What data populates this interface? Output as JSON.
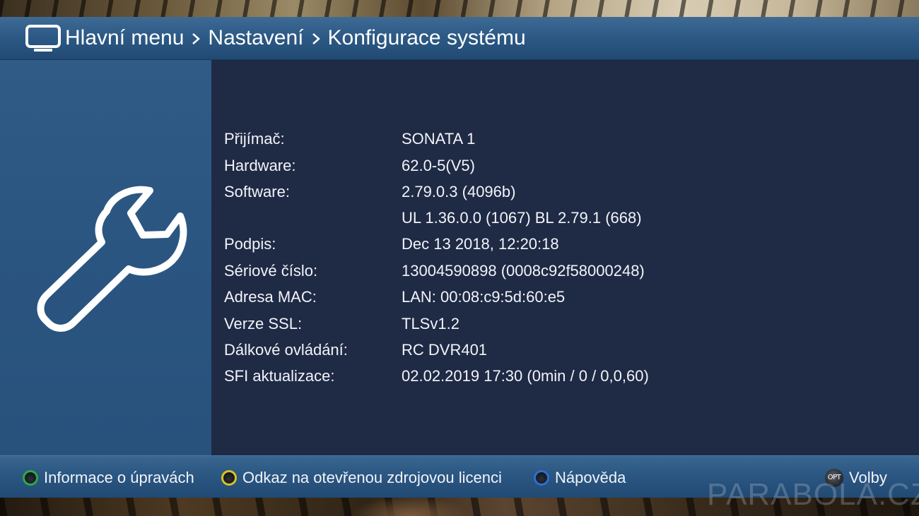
{
  "header": {
    "icon": "tv-icon",
    "breadcrumb": [
      "Hlavní menu",
      "Nastavení",
      "Konfigurace systému"
    ],
    "separator_icon": "chevron-right-icon"
  },
  "left_panel": {
    "icon": "wrench-icon"
  },
  "system_info": [
    {
      "label": "Přijímač:",
      "value": "SONATA 1"
    },
    {
      "label": "Hardware:",
      "value": "62.0-5(V5)"
    },
    {
      "label": "Software:",
      "value": "2.79.0.3 (4096b)"
    },
    {
      "label": "",
      "value": "UL 1.36.0.0 (1067) BL 2.79.1 (668)"
    },
    {
      "label": "Podpis:",
      "value": "Dec 13 2018, 12:20:18"
    },
    {
      "label": "Sériové číslo:",
      "value": "13004590898 (0008c92f58000248)"
    },
    {
      "label": "Adresa MAC:",
      "value": "LAN: 00:08:c9:5d:60:e5"
    },
    {
      "label": "Verze SSL:",
      "value": "TLSv1.2"
    },
    {
      "label": "Dálkové ovládání:",
      "value": "RC DVR401"
    },
    {
      "label": "SFI aktualizace:",
      "value": "02.02.2019 17:30 (0min / 0 / 0,0,60)"
    }
  ],
  "footer": {
    "green": {
      "label": "Informace o úpravách",
      "color": "#2fa84a"
    },
    "yellow": {
      "label": "Odkaz na otevřenou zdrojovou licenci",
      "color": "#d9c21e"
    },
    "blue": {
      "label": "Nápověda",
      "color": "#2f6fd0"
    },
    "opt": {
      "button_text": "OPT",
      "label": "Volby"
    }
  },
  "watermark": "PARABOLA.CZ",
  "colors": {
    "header_bar": "#2d5a86",
    "left_panel": "#2a5580",
    "main_panel": "#1f2a45",
    "text": "#f2f4f8"
  }
}
